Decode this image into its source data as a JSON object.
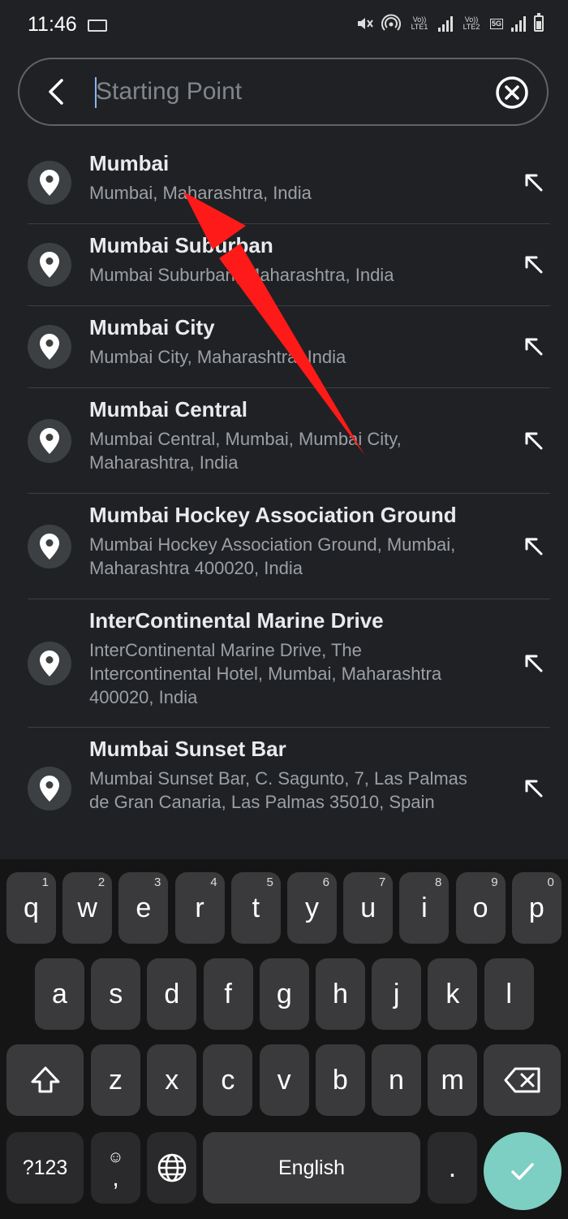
{
  "status_bar": {
    "time": "11:46",
    "net1": "Vo)) LTE1",
    "net2": "Vo)) LTE2",
    "five_g": "5G"
  },
  "search": {
    "placeholder": "Starting Point",
    "value": ""
  },
  "results": [
    {
      "title": "Mumbai",
      "subtitle": "Mumbai, Maharashtra, India"
    },
    {
      "title": "Mumbai Suburban",
      "subtitle": "Mumbai Suburban, Maharashtra, India"
    },
    {
      "title": "Mumbai City",
      "subtitle": "Mumbai City, Maharashtra, India"
    },
    {
      "title": "Mumbai Central",
      "subtitle": "Mumbai Central, Mumbai, Mumbai City, Maharashtra, India"
    },
    {
      "title": "Mumbai Hockey Association Ground",
      "subtitle": "Mumbai Hockey Association Ground, Mumbai, Maharashtra 400020, India"
    },
    {
      "title": "InterContinental Marine Drive",
      "subtitle": "InterContinental Marine Drive, The Intercontinental Hotel, Mumbai, Maharashtra 400020, India"
    },
    {
      "title": "Mumbai Sunset Bar",
      "subtitle": "Mumbai Sunset Bar, C. Sagunto, 7, Las Palmas de Gran Canaria, Las Palmas 35010, Spain"
    }
  ],
  "keyboard": {
    "row1": [
      {
        "key": "q",
        "num": "1"
      },
      {
        "key": "w",
        "num": "2"
      },
      {
        "key": "e",
        "num": "3"
      },
      {
        "key": "r",
        "num": "4"
      },
      {
        "key": "t",
        "num": "5"
      },
      {
        "key": "y",
        "num": "6"
      },
      {
        "key": "u",
        "num": "7"
      },
      {
        "key": "i",
        "num": "8"
      },
      {
        "key": "o",
        "num": "9"
      },
      {
        "key": "p",
        "num": "0"
      }
    ],
    "row2": [
      "a",
      "s",
      "d",
      "f",
      "g",
      "h",
      "j",
      "k",
      "l"
    ],
    "row3": [
      "z",
      "x",
      "c",
      "v",
      "b",
      "n",
      "m"
    ],
    "symbols_label": "?123",
    "comma": ",",
    "space_label": "English",
    "period": ".",
    "enter_icon": "check-icon"
  },
  "colors": {
    "background": "#202124",
    "annotation_arrow": "#ff1a1a",
    "enter_key": "#7ccfc2"
  }
}
